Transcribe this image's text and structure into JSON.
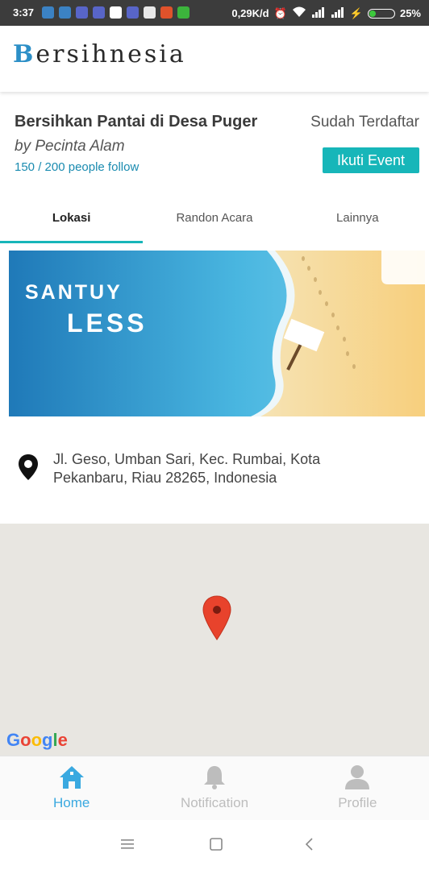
{
  "status_bar": {
    "time": "3:37",
    "network_speed": "0,29K/d",
    "battery_level": "25%",
    "battery_fraction": 0.25
  },
  "app": {
    "logo_initial": "B",
    "logo_rest": "ersihnesia",
    "accent_color": "#17b6b9"
  },
  "event": {
    "title": "Bersihkan Pantai di Desa Puger",
    "organizer": "by Pecinta Alam",
    "followers": "150 / 200 people follow",
    "registration_status": "Sudah Terdaftar",
    "join_button": "Ikuti Event"
  },
  "tabs": [
    {
      "label": "Lokasi",
      "active": true
    },
    {
      "label": "Randon Acara",
      "active": false
    },
    {
      "label": "Lainnya",
      "active": false
    }
  ],
  "banner": {
    "line1": "SANTUY",
    "line2": "LESS"
  },
  "location": {
    "address": "Jl. Geso, Umban Sari, Kec. Rumbai, Kota Pekanbaru, Riau 28265, Indonesia",
    "map_attribution": "Google"
  },
  "bottom_nav": [
    {
      "label": "Home",
      "icon": "home-icon",
      "active": true
    },
    {
      "label": "Notification",
      "icon": "bell-icon",
      "active": false
    },
    {
      "label": "Profile",
      "icon": "person-icon",
      "active": false
    }
  ]
}
